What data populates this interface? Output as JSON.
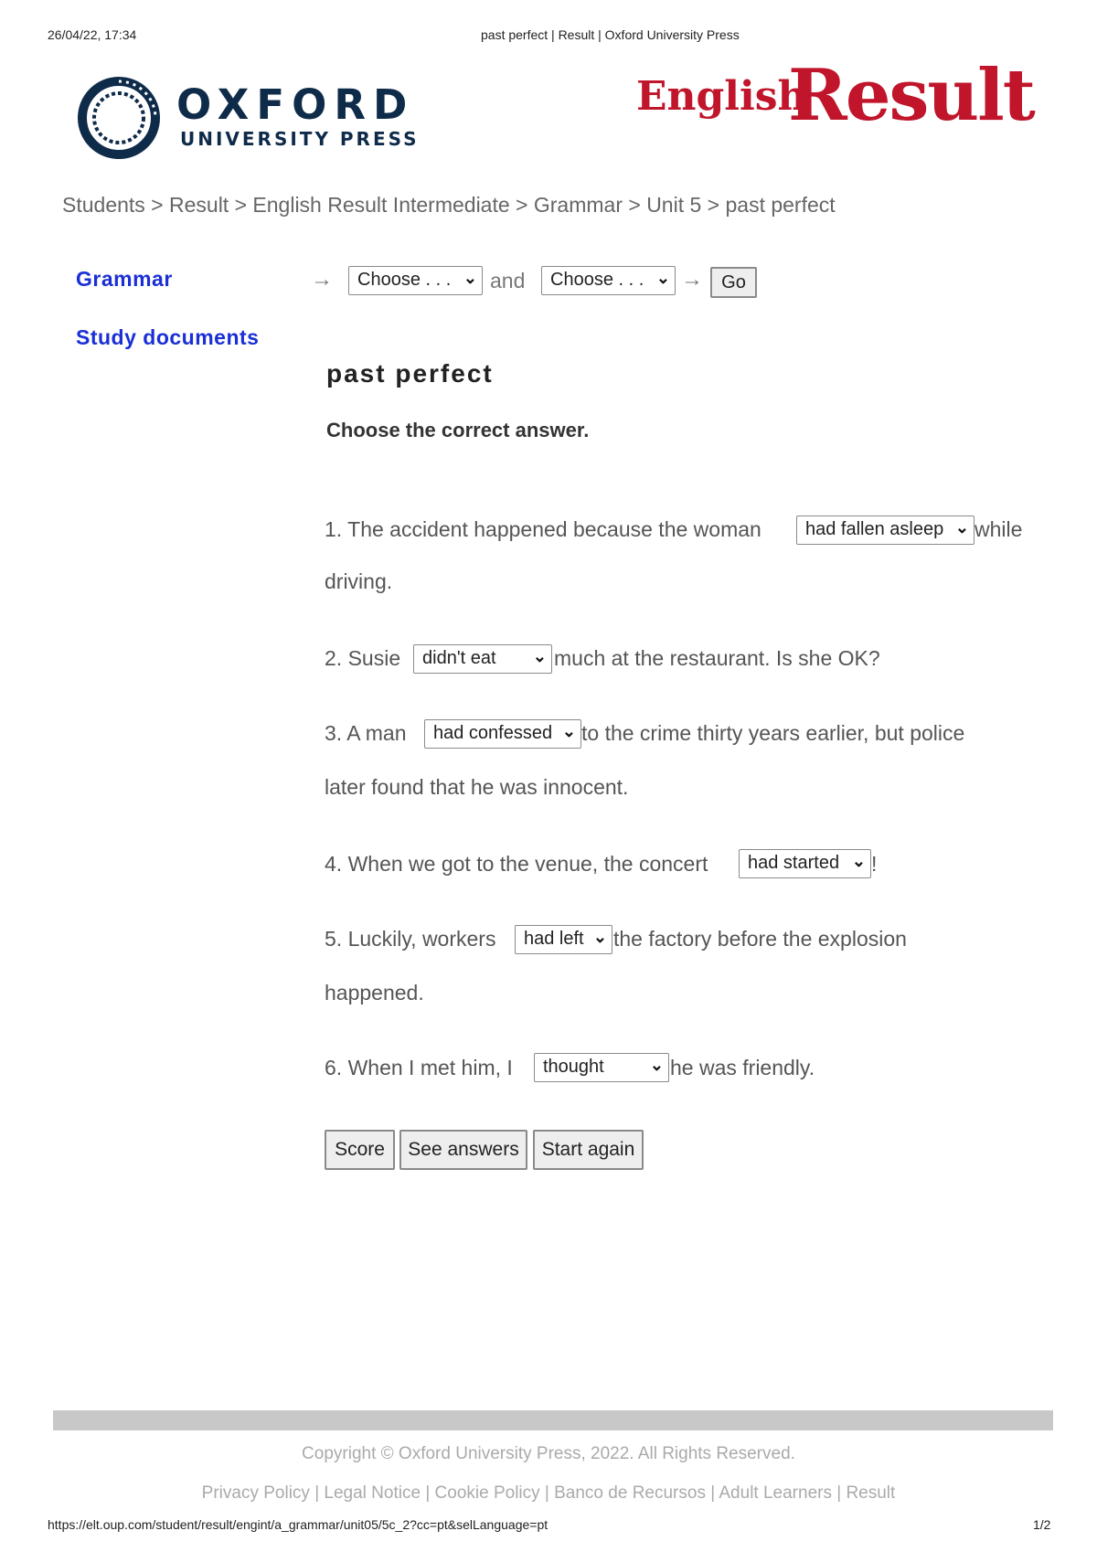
{
  "print_header": {
    "datetime": "26/04/22, 17:34",
    "title": "past perfect | Result | Oxford University Press"
  },
  "logos": {
    "oxford_main": "OXFORD",
    "oxford_sub": "UNIVERSITY PRESS",
    "er_english": "English",
    "er_result": "Result",
    "brand_red": "#c0152b",
    "oxford_navy": "#0f2b4a"
  },
  "breadcrumb": {
    "text": "Students > Result > English Result Intermediate > Grammar > Unit 5 > past perfect"
  },
  "nav": {
    "grammar": "Grammar",
    "study_documents": "Study documents",
    "link_color": "#1a2fd6"
  },
  "chooser": {
    "arrow": "→",
    "select1": "Choose . . .",
    "and": "and",
    "select2": "Choose . . .",
    "go": "Go"
  },
  "exercise": {
    "title": "past perfect",
    "instruction": "Choose the correct answer.",
    "q1": {
      "before": "1. The accident happened because the woman",
      "answer": "had fallen asleep",
      "after": "while",
      "cont": "driving."
    },
    "q2": {
      "before": "2. Susie",
      "answer": "didn't eat",
      "after": "much at the restaurant. Is she OK?"
    },
    "q3": {
      "before": "3. A man",
      "answer": "had confessed",
      "after": "to the crime thirty years earlier, but police",
      "cont": "later found that he was innocent."
    },
    "q4": {
      "before": "4. When we got to the venue, the concert",
      "answer": "had started",
      "after": "!"
    },
    "q5": {
      "before": "5. Luckily, workers",
      "answer": "had left",
      "after": "the factory before the explosion",
      "cont": "happened."
    },
    "q6": {
      "before": "6. When I met him, I",
      "answer": "thought",
      "after": "he was friendly."
    }
  },
  "buttons": {
    "score": "Score",
    "see_answers": "See answers",
    "start_again": "Start again"
  },
  "footer": {
    "copyright": "Copyright © Oxford University Press, 2022. All Rights Reserved.",
    "links": "Privacy Policy | Legal Notice | Cookie Policy | Banco de Recursos | Adult Learners | Result"
  },
  "print_footer": {
    "url": "https://elt.oup.com/student/result/engint/a_grammar/unit05/5c_2?cc=pt&selLanguage=pt",
    "page": "1/2"
  }
}
